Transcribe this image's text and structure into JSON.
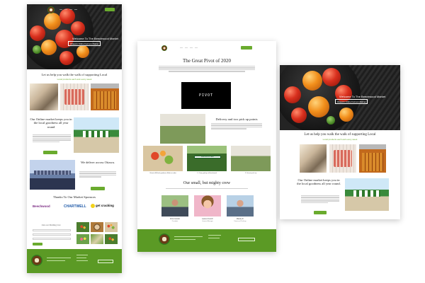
{
  "colors": {
    "brand_green": "#6aab2e",
    "footer_green": "#5b9a25",
    "accent_text": "#6aab2e"
  },
  "left_page": {
    "hero_title": "Welcome To The Beechwood Market",
    "hero_subtitle": "Ottawa's Online Farmers Market",
    "help_heading": "Let us help you walk the walk of supporting Local",
    "help_sub": "Local products each and every week",
    "online_heading": "Our Online market keeps you in the local goodness all year round",
    "deliver_heading": "We deliver across Ottawa.",
    "sponsors_heading": "Thanks To Our Market Sponsors",
    "sponsors": [
      "Beechwood",
      "CHARTWELL",
      "get cracking"
    ],
    "mailing_heading": "Join our Mailing List",
    "button_label": "",
    "icons": [
      "market-logo-icon"
    ]
  },
  "middle_page": {
    "title": "The Great Pivot of 2020",
    "video_label": "PIVOT",
    "delivery_heading": "Delivery and two pick up points",
    "captions": [
      "Ottawa's All local goodness Made on order",
      "2. Cherry pickup at Beechwood",
      "3. Drive-in pick up"
    ],
    "crew_heading": "Our small, but mighty crew",
    "crew": [
      {
        "name": "Chris Gordon",
        "role": "President"
      },
      {
        "name": "Lauren French",
        "role": "General Manager"
      },
      {
        "name": "Mandy R.",
        "role": "Director of Delivery"
      }
    ]
  },
  "right_page": {
    "hero_title": "Welcome To The Beechwood Market",
    "hero_subtitle": "Ottawa's Online Farmers Market",
    "help_heading": "Let us help you walk the walk of supporting Local",
    "help_sub": "Local products each and every week",
    "online_heading": "Our Online market keeps you in the local goodness all year round."
  }
}
